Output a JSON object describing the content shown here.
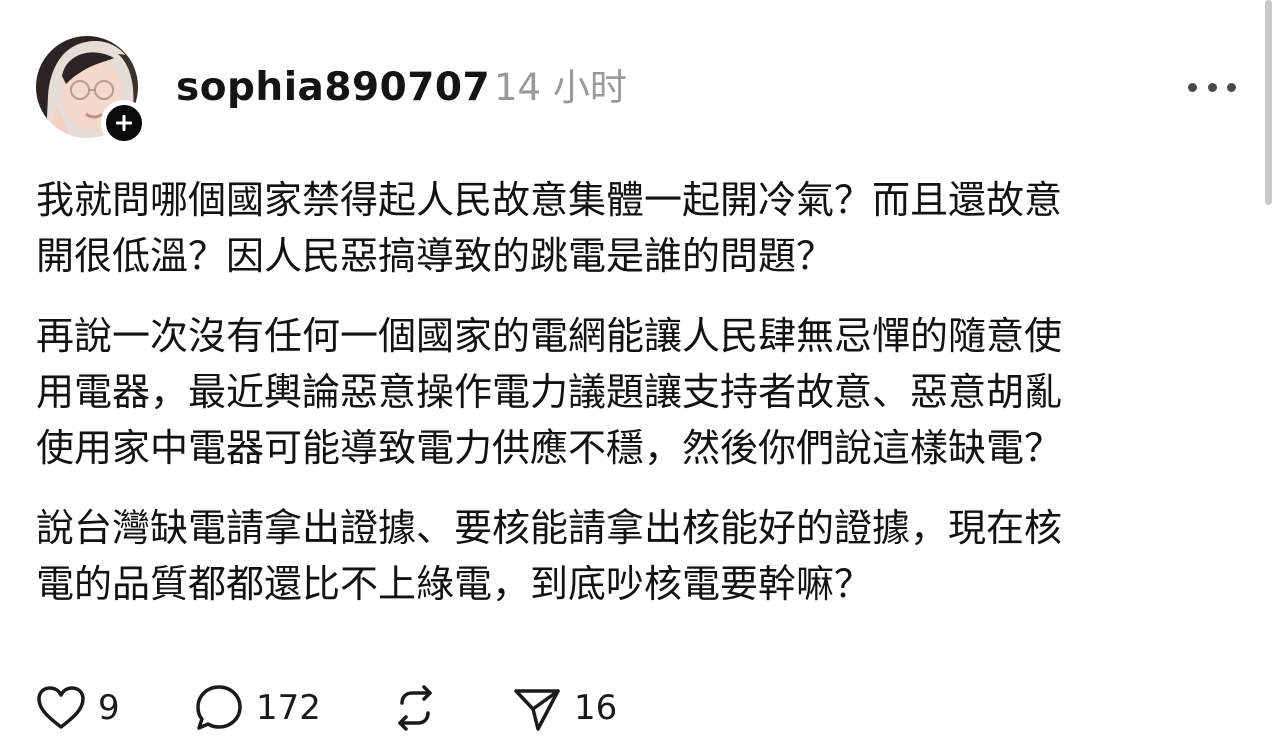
{
  "post": {
    "author": {
      "username": "sophia890707",
      "timestamp": "14 小时"
    },
    "paragraphs": [
      "我就問哪個國家禁得起人民故意集體一起開冷氣？而且還故意\n開很低溫？因人民惡搞導致的跳電是誰的問題？",
      "再說一次沒有任何一個國家的電網能讓人民肆無忌憚的隨意使\n用電器，最近輿論惡意操作電力議題讓支持者故意、惡意胡亂\n使用家中電器可能導致電力供應不穩，然後你們說這樣缺電？",
      "說台灣缺電請拿出證據、要核能請拿出核能好的證據，現在核\n電的品質都都還比不上綠電，到底吵核電要幹嘛？"
    ],
    "actions": {
      "likes": "9",
      "comments": "172",
      "shares": "16"
    }
  },
  "icons": {
    "like": "heart-icon",
    "comment": "comment-bubble-icon",
    "repost": "repost-icon",
    "share": "send-icon",
    "follow": "plus-icon",
    "more": "more-horizontal-icon"
  },
  "colors": {
    "text": "#121212",
    "muted": "#9a9a9a",
    "badge": "#0b0b0b"
  }
}
